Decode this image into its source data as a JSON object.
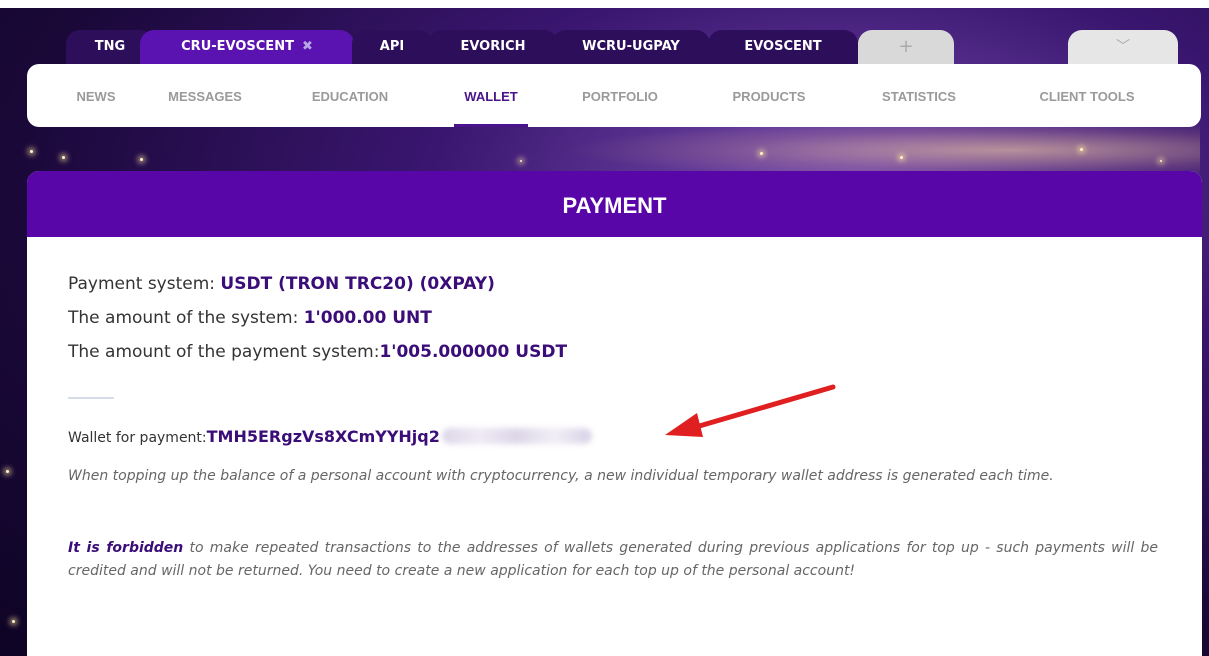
{
  "tabs": [
    {
      "label": "TNG"
    },
    {
      "label": "CRU-EVOSCENT",
      "close": "✖"
    },
    {
      "label": "API"
    },
    {
      "label": "EVORICH"
    },
    {
      "label": "WCRU-UGPAY"
    },
    {
      "label": "EVOSCENT"
    },
    {
      "label": "+"
    },
    {
      "label": "﹀"
    }
  ],
  "nav": [
    "NEWS",
    "MESSAGES",
    "EDUCATION",
    "WALLET",
    "PORTFOLIO",
    "PRODUCTS",
    "STATISTICS",
    "CLIENT TOOLS"
  ],
  "payment": {
    "title": "PAYMENT",
    "system_label": "Payment system: ",
    "system_value": "USDT (TRON TRC20) (0XPAY)",
    "amount_system_label": "The amount of the system: ",
    "amount_system_value": "1'000.00 UNT",
    "amount_ps_label": "The amount of the payment system:",
    "amount_ps_value": "1'005.000000 USDT",
    "wallet_label": "Wallet for payment:",
    "wallet_value": "TMH5ERgzVs8XCmYYHjq2",
    "note1": "When topping up the balance of a personal account with cryptocurrency, a new individual temporary wallet address is generated each time.",
    "note2_bold": "It is forbidden",
    "note2_rest": " to make repeated transactions to the addresses of wallets generated during previous applications for top up - such payments will be credited and will not be returned. You need to create a new application for each top up of the personal account!"
  },
  "colors": {
    "accent": "#5806a8",
    "arrow": "#e02020"
  }
}
